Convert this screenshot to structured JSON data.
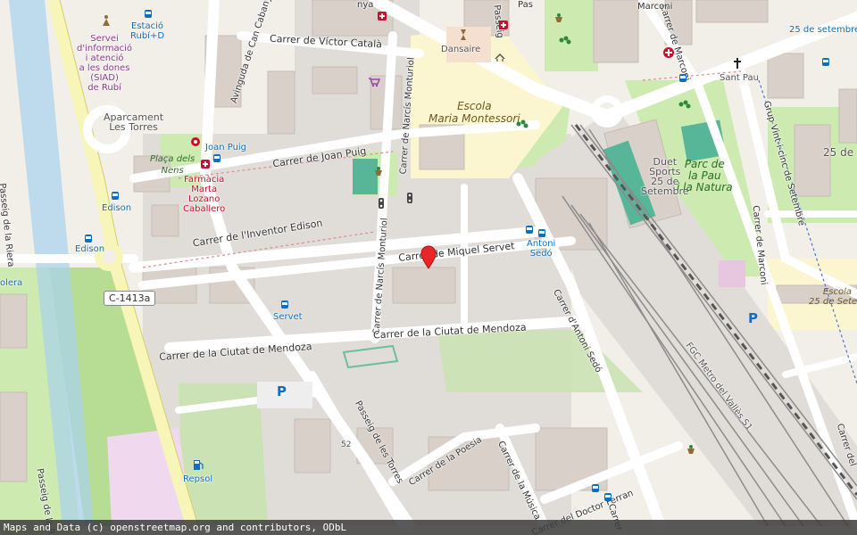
{
  "map": {
    "marker_color": "#e8262a",
    "colors": {
      "background": "#f2efe9",
      "building": "#d9d0c9",
      "park": "#cdebb0",
      "school": "#fcf6d0",
      "road": "#ffffff",
      "primary_road": "#fcd6a4",
      "rail": "#8c8c8c",
      "river": "#a8d1ee",
      "grass": "#cbe3b4"
    },
    "streets": [
      "Carrer de Víctor Català",
      "Avinguda de Can Cabanyes",
      "Carrer de Narcís Monturiol",
      "Carrer de Joan Puig",
      "Carrer de l'Inventor Edison",
      "Carrer de Miquel Servet",
      "Carrer de Narcís Monturiol",
      "Carrer de la Ciutat de Mendoza",
      "Carrer de la Ciutat de Mendoza",
      "Carrer d'Antoni Sedó",
      "Passeig de les Torres",
      "Carrer de la Poesia",
      "Carrer de la Música",
      "Carrer del Doctor Ferran",
      "Passeig de la Riera",
      "Passeig de la Riera",
      "Grup Vint-i-cinc de Setembre",
      "Carrer de Marconi",
      "Carrer de Marconi",
      "Carrer del",
      "Passeig",
      "Carrer"
    ],
    "poi_labels": {
      "servei": "Servei\nd'informació\ni atenció\na les dones\n(SIAD)\nde Rubí",
      "estacio": "Estació\nRubí+D",
      "aparcament": "Aparcament\nLes Torres",
      "joan_puig": "Joan Puig",
      "placa_nens": "Plaça dels\nNens",
      "farmacia": "Farmàcia\nMarta\nLozano\nCaballero",
      "edison1": "Edison",
      "edison2": "Edison",
      "dansaire": "Dansaire",
      "escola": "Escola\nMaria Montessori",
      "antoni_sedo": "Antoni\nSedó",
      "servet": "Servet",
      "duet": "Duet\nSports\n25 de\nSetembre",
      "parc": "Parc de\nla Pau\ni la Natura",
      "sant_pau": "Sant Pau",
      "setembre_top": "25 de setembre",
      "setembre_mid": "25 de S",
      "escola25": "Escola\n25 de Setem",
      "repsol": "Repsol",
      "number52": "52",
      "rail": "FGC Metro del Vallès S1",
      "road_badge": "C-1413a",
      "marconi_top": "Marconi",
      "ola": "olera",
      "nya": "nya",
      "pas": "Pas"
    },
    "attribution": "Maps and Data (c) openstreetmap.org and contributors, ODbL"
  }
}
